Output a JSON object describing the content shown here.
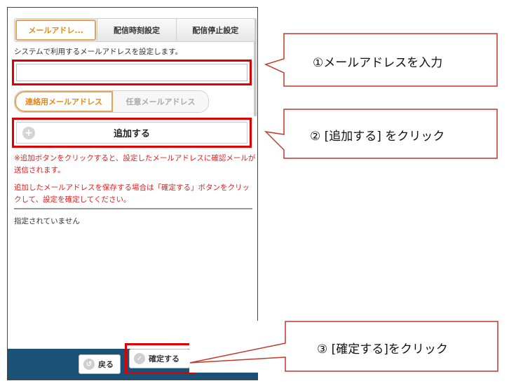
{
  "tabs": [
    {
      "label": "メールアドレ..."
    },
    {
      "label": "配信時刻設定"
    },
    {
      "label": "配信停止設定"
    }
  ],
  "description": "システムで利用するメールアドレスを設定します。",
  "email_input": {
    "value": "",
    "placeholder": ""
  },
  "address_types": [
    {
      "label": "連絡用メールアドレス"
    },
    {
      "label": "任意メールアドレス"
    }
  ],
  "add_button": {
    "label": "追加する"
  },
  "notes": [
    "※追加ボタンをクリックすると、設定したメールアドレスに確認メールが送信されます。",
    "追加したメールアドレスを保存する場合は「確定する」ボタンをクリックして、設定を確定してください。"
  ],
  "empty_state": "指定されていません",
  "footer": {
    "back_label": "戻る",
    "confirm_label": "確定する"
  },
  "callouts": [
    {
      "text": "①メールアドレスを入力"
    },
    {
      "text": "② [追加する] をクリック"
    },
    {
      "text": "③ [確定する]をクリック"
    }
  ],
  "colors": {
    "accent": "#e28a1c",
    "highlight": "#e00000",
    "note": "#e0201f",
    "footer": "#1a5177"
  }
}
